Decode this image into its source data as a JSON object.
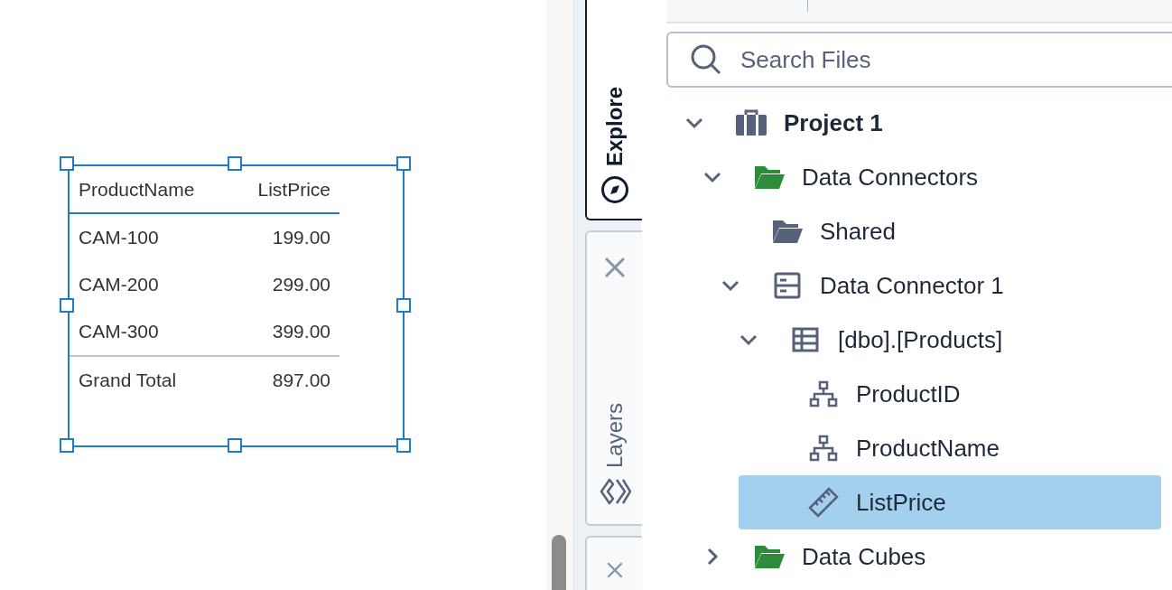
{
  "report_table": {
    "columns": [
      "ProductName",
      "ListPrice"
    ],
    "rows": [
      [
        "CAM-100",
        "199.00"
      ],
      [
        "CAM-200",
        "299.00"
      ],
      [
        "CAM-300",
        "399.00"
      ]
    ],
    "total": [
      "Grand Total",
      "897.00"
    ]
  },
  "side_tabs": [
    {
      "label": "Explore",
      "selected": true,
      "closable": false
    },
    {
      "label": "Layers",
      "selected": false,
      "closable": true
    },
    {
      "selected": false,
      "closable": true
    }
  ],
  "search": {
    "placeholder": "Search Files"
  },
  "tree": [
    {
      "label": "Project 1",
      "kind": "project",
      "expanded": true,
      "selected": false,
      "children": [
        {
          "label": "Data Connectors",
          "kind": "folder-green",
          "expanded": true,
          "selected": false,
          "children": [
            {
              "label": "Shared",
              "kind": "folder",
              "selected": false
            },
            {
              "label": "Data Connector 1",
              "kind": "connector",
              "expanded": true,
              "selected": false,
              "children": [
                {
                  "label": "[dbo].[Products]",
                  "kind": "table",
                  "expanded": true,
                  "selected": false,
                  "children": [
                    {
                      "label": "ProductID",
                      "kind": "hierarchy",
                      "selected": false
                    },
                    {
                      "label": "ProductName",
                      "kind": "hierarchy",
                      "selected": false
                    },
                    {
                      "label": "ListPrice",
                      "kind": "measure",
                      "selected": true
                    }
                  ]
                }
              ]
            }
          ]
        },
        {
          "label": "Data Cubes",
          "kind": "folder-green",
          "expanded": false,
          "selected": false
        }
      ]
    }
  ]
}
